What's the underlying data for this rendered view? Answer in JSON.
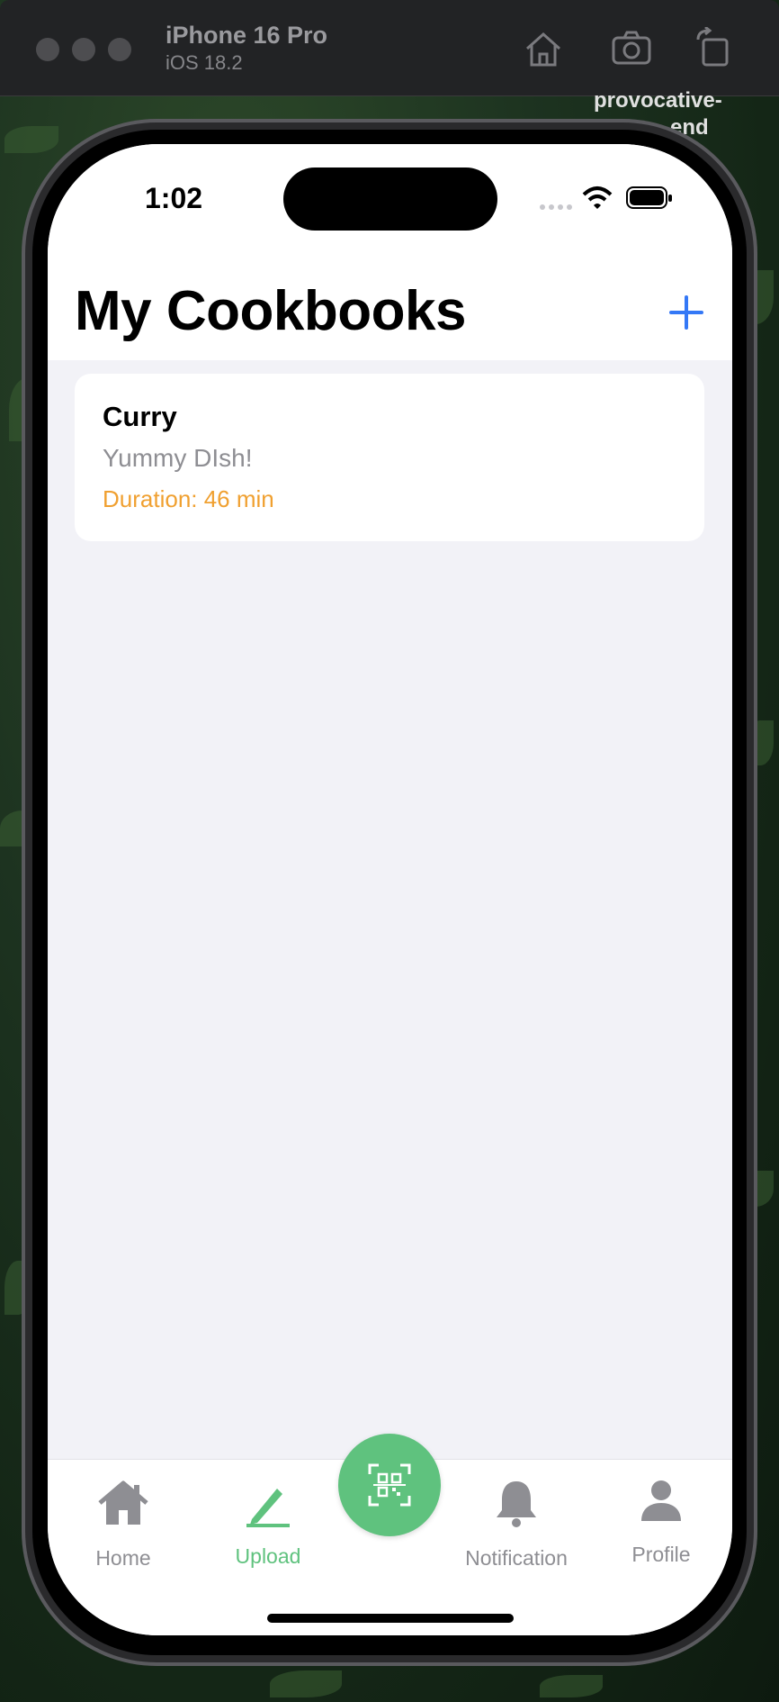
{
  "simulator": {
    "device_name": "iPhone 16 Pro",
    "os_version": "iOS 18.2",
    "buttons": [
      "home-icon",
      "screenshot-icon",
      "rotate-icon"
    ]
  },
  "desktop": {
    "label_line1": "provocative-",
    "label_line2": "end"
  },
  "status_bar": {
    "time": "1:02",
    "icons": [
      "signal-icon",
      "wifi-icon",
      "battery-icon"
    ]
  },
  "nav": {
    "title": "My Cookbooks",
    "add_icon": "plus-icon",
    "accent": "#3478f6"
  },
  "cookbooks": [
    {
      "title": "Curry",
      "description": "Yummy DIsh!",
      "duration": "Duration: 46 min"
    }
  ],
  "colors": {
    "duration": "#f0a030",
    "tab_active": "#5fc27e",
    "tab_inactive": "#8e8e93",
    "background": "#f2f2f7"
  },
  "tab_bar": {
    "tabs": [
      {
        "label": "Home",
        "icon": "house-icon",
        "active": false
      },
      {
        "label": "Upload",
        "icon": "pencil-icon",
        "active": true
      },
      {
        "label": "Notification",
        "icon": "bell-icon",
        "active": false
      },
      {
        "label": "Profile",
        "icon": "person-icon",
        "active": false
      }
    ],
    "center_button_icon": "qr-scan-icon"
  }
}
